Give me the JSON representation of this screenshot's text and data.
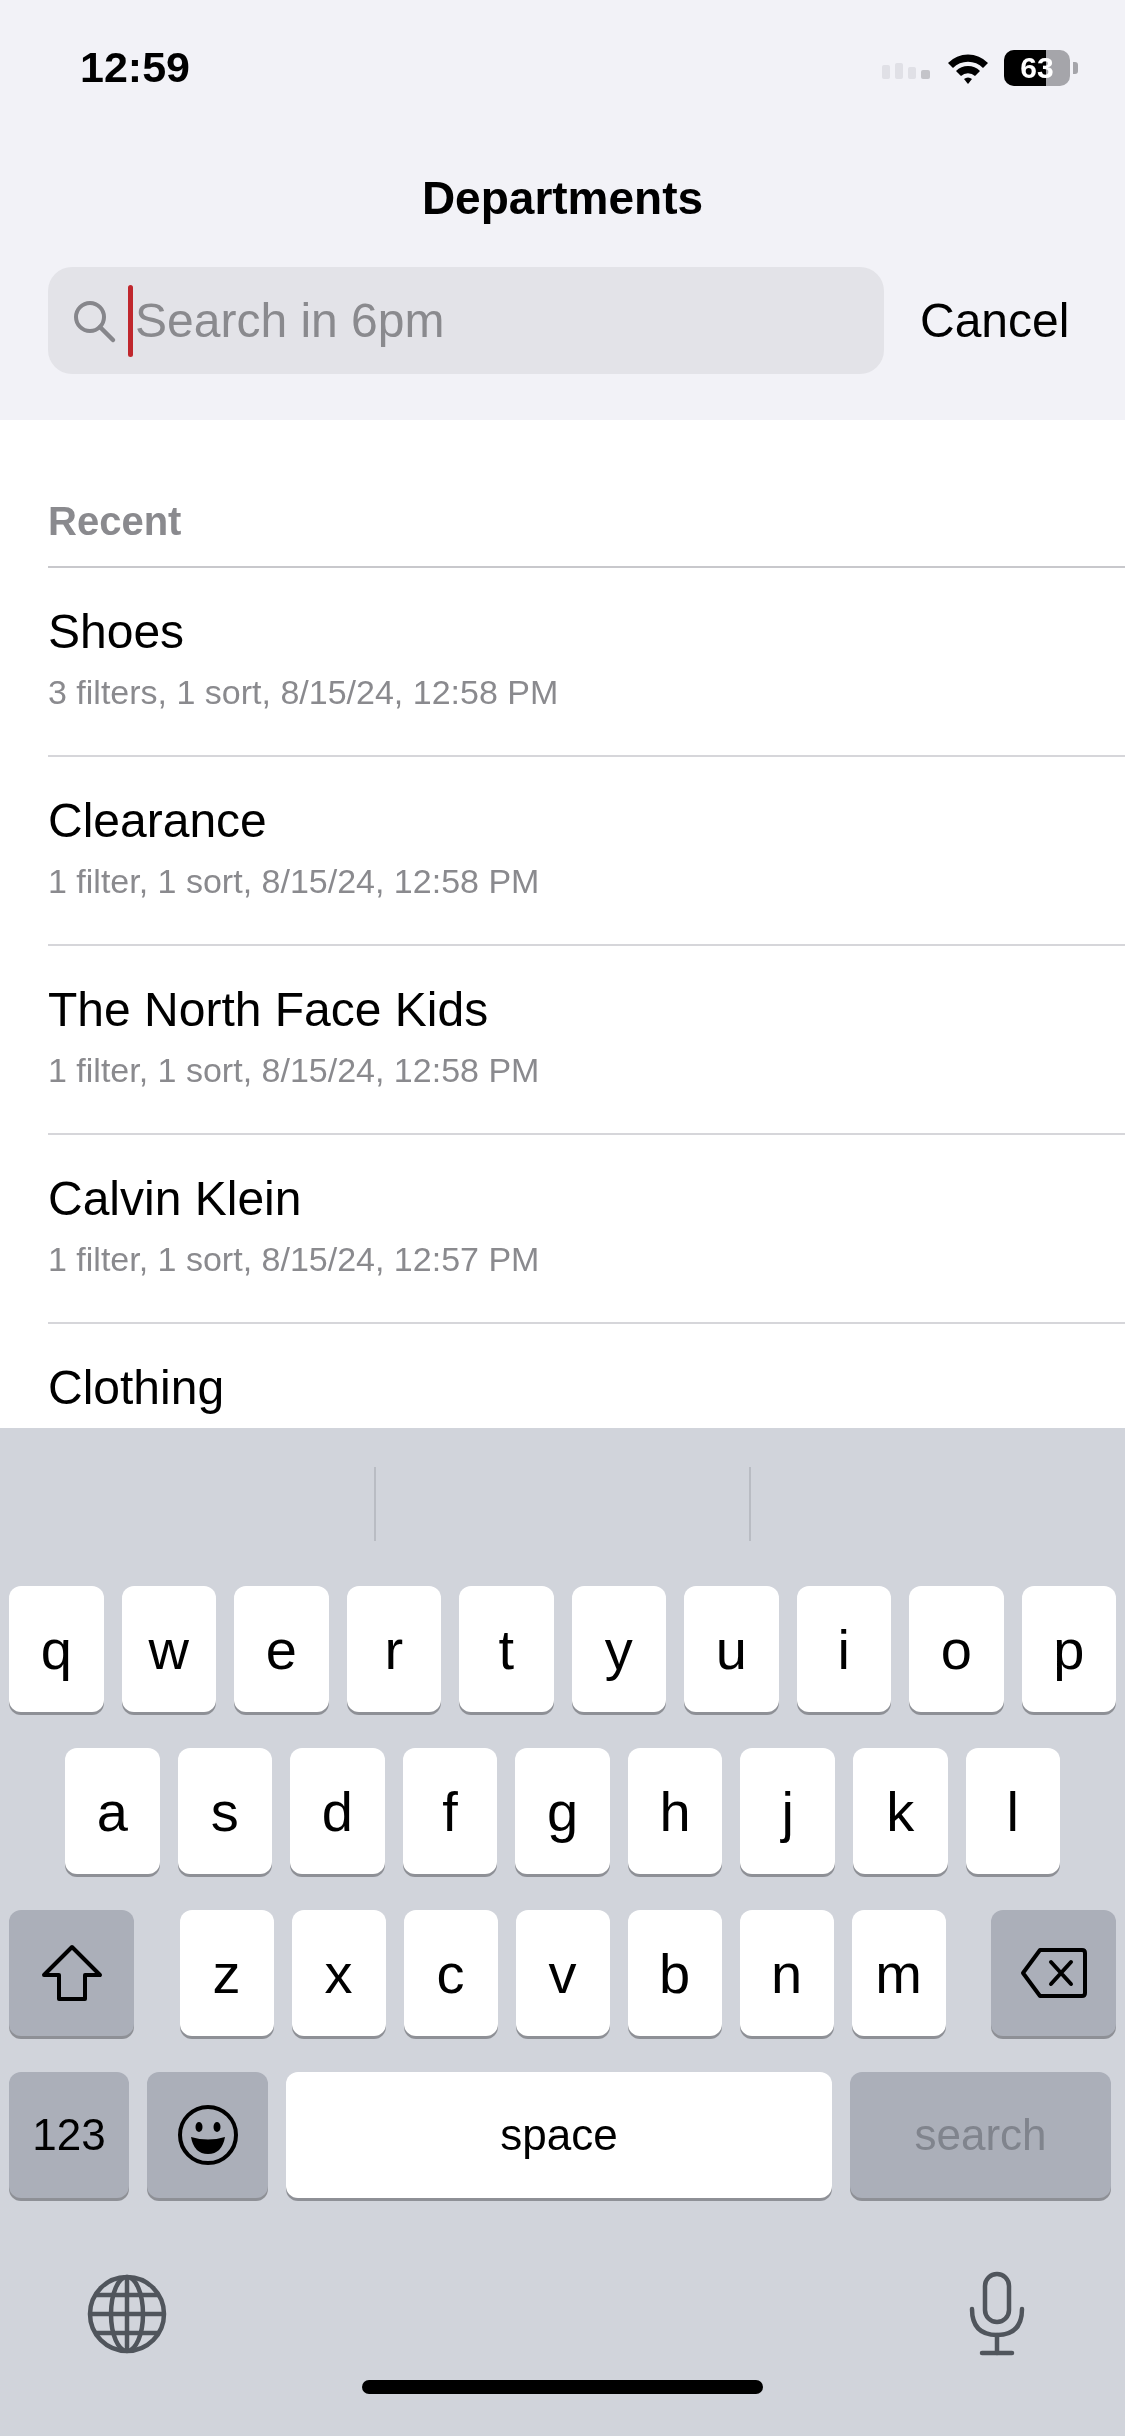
{
  "status_bar": {
    "time": "12:59",
    "battery": "63"
  },
  "title": "Departments",
  "search": {
    "placeholder": "Search in 6pm",
    "focused": true
  },
  "cancel": "Cancel",
  "section": "Recent",
  "recent": [
    {
      "title": "Shoes",
      "subtitle": "3 filters, 1 sort, 8/15/24, 12:58 PM"
    },
    {
      "title": "Clearance",
      "subtitle": "1 filter, 1 sort, 8/15/24, 12:58 PM"
    },
    {
      "title": "The North Face Kids",
      "subtitle": "1 filter, 1 sort, 8/15/24, 12:58 PM"
    },
    {
      "title": "Calvin Klein",
      "subtitle": "1 filter, 1 sort, 8/15/24, 12:57 PM"
    },
    {
      "title": "Clothing"
    }
  ],
  "keyboard": {
    "rows": [
      [
        "q",
        "w",
        "e",
        "r",
        "t",
        "y",
        "u",
        "i",
        "o",
        "p"
      ],
      [
        "a",
        "s",
        "d",
        "f",
        "g",
        "h",
        "j",
        "k",
        "l"
      ],
      [
        "z",
        "x",
        "c",
        "v",
        "b",
        "n",
        "m"
      ]
    ],
    "numbers_key": "123",
    "space_key": "space",
    "return_key": {
      "label": "search",
      "disabled": true
    }
  }
}
